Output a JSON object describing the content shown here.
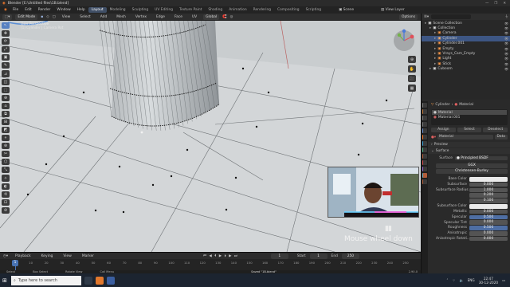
{
  "window": {
    "title": "Blender [E:\\Untitled files\\1B.blend]",
    "controls": [
      "—",
      "❐",
      "✕"
    ]
  },
  "menus": [
    "File",
    "Edit",
    "Render",
    "Window",
    "Help"
  ],
  "workspaces": [
    "Layout",
    "Modeling",
    "Sculpting",
    "UV Editing",
    "Texture Paint",
    "Shading",
    "Animation",
    "Rendering",
    "Compositing",
    "Scripting"
  ],
  "active_workspace": "Layout",
  "top_right": {
    "scene": "Scene",
    "view_layer": "View Layer"
  },
  "viewport_header": {
    "mode": "Edit Mode",
    "menus": [
      "View",
      "Select",
      "Add",
      "Mesh",
      "Vertex",
      "Edge",
      "Face",
      "UV"
    ],
    "transform": "Global",
    "overlay": "Options"
  },
  "viewport_info": {
    "line1": "User Perspective",
    "line2": "(1) Cylinder | Camera Rot"
  },
  "overlay_text": {
    "shortcut": "Mouse wheel down",
    "pause_glyph": "▮▮"
  },
  "tools": [
    "↖",
    "✥",
    "⟳",
    "⤢",
    "▣",
    "✎",
    "⊿",
    "◫",
    "⬚",
    "⊕",
    "⌂",
    "⧉",
    "⊞",
    "◩",
    "⋄",
    "⊛",
    "✂",
    "⬡",
    "⤡",
    "✧",
    "◐",
    "⟲",
    "⊡",
    "⊘"
  ],
  "outliner": {
    "title": "Scene Collection",
    "items": [
      {
        "label": "Scene Collection",
        "indent": 0,
        "color": "#e8e8e8"
      },
      {
        "label": "Collection",
        "indent": 1,
        "color": "#e8e8e8"
      },
      {
        "label": "Camera",
        "indent": 2,
        "color": "#ff9b4a"
      },
      {
        "label": "Cylinder",
        "indent": 2,
        "color": "#ffb56b",
        "selected": true
      },
      {
        "label": "Cylinder.001",
        "indent": 2,
        "color": "#ff9b4a"
      },
      {
        "label": "Empty",
        "indent": 2,
        "color": "#ff9b4a"
      },
      {
        "label": "Vrays_Cam_Empty",
        "indent": 2,
        "color": "#ff9b4a"
      },
      {
        "label": "Light",
        "indent": 2,
        "color": "#ff9b4a"
      },
      {
        "label": "Stick",
        "indent": 2,
        "color": "#ff9b4a"
      },
      {
        "label": "Cuboom",
        "indent": 1,
        "color": "#e8e8e8"
      }
    ]
  },
  "properties": {
    "breadcrumb": [
      "Cylinder",
      "Material"
    ],
    "slots": [
      "Material",
      "Material.001"
    ],
    "slot_buttons": [
      "Assign",
      "Select",
      "Deselect"
    ],
    "material_name": "Material",
    "data_label": "Data",
    "preview": "Preview",
    "surface_panel": "Surface",
    "surface": "Principled BSDF",
    "distribution": "GGX",
    "subsurface_method": "Christensen-Burley",
    "rows": [
      {
        "label": "Base Color",
        "value": "",
        "style": "white"
      },
      {
        "label": "Subsurface",
        "value": "0.000",
        "style": "normal"
      },
      {
        "label": "Subsurface Radius",
        "value": "1.000",
        "style": "normal"
      },
      {
        "label": "",
        "value": "0.200",
        "style": "normal"
      },
      {
        "label": "",
        "value": "0.100",
        "style": "normal"
      },
      {
        "label": "Subsurface Color",
        "value": "",
        "style": "white"
      },
      {
        "label": "Metallic",
        "value": "0.000",
        "style": "normal"
      },
      {
        "label": "Specular",
        "value": "0.500",
        "style": "blue"
      },
      {
        "label": "Specular Tint",
        "value": "0.000",
        "style": "normal"
      },
      {
        "label": "Roughness",
        "value": "0.500",
        "style": "blue"
      },
      {
        "label": "Anisotropic",
        "value": "0.000",
        "style": "normal"
      },
      {
        "label": "Anisotropic Rotati...",
        "value": "0.000",
        "style": "normal"
      }
    ]
  },
  "timeline": {
    "menus": [
      "Playback",
      "Keying",
      "View",
      "Marker"
    ],
    "start_label": "Start",
    "start": "1",
    "end_label": "End",
    "end": "250",
    "current": "1",
    "ticks": [
      "0",
      "10",
      "20",
      "30",
      "40",
      "50",
      "60",
      "70",
      "80",
      "90",
      "100",
      "110",
      "120",
      "130",
      "140",
      "150",
      "160",
      "170",
      "180",
      "190",
      "200",
      "210",
      "220",
      "230",
      "240",
      "250"
    ]
  },
  "statusbar": {
    "items": [
      "Select",
      "Box Select",
      "Rotate View",
      "Call Menu"
    ],
    "info": "Saved \"1B.blend\"",
    "version": "2.90.0"
  },
  "taskbar": {
    "search_placeholder": "Type here to search",
    "lang": "ENG",
    "time": "22:47",
    "date": "30-12-2020"
  },
  "colors": {
    "accent": "#5680c2",
    "selected": "#3d5683",
    "active_ws": "#404f66"
  }
}
